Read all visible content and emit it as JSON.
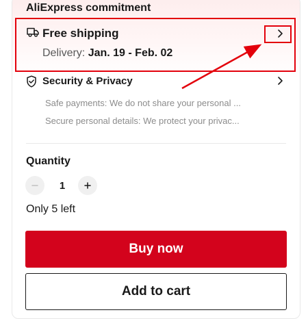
{
  "commitment": {
    "title": "AliExpress commitment"
  },
  "shipping": {
    "icon": "truck-icon",
    "label": "Free shipping",
    "delivery_prefix": "Delivery:",
    "delivery_dates": "Jan. 19 - Feb. 02"
  },
  "security": {
    "icon": "shield-check-icon",
    "label": "Security & Privacy",
    "lines": [
      "Safe payments: We do not share your personal ...",
      "Secure personal details: We protect your privac..."
    ]
  },
  "quantity": {
    "title": "Quantity",
    "value": "1",
    "stock": "Only 5 left"
  },
  "actions": {
    "buy_now": "Buy now",
    "add_to_cart": "Add to cart"
  },
  "colors": {
    "accent": "#d3031c",
    "annotation": "#e3000b"
  }
}
